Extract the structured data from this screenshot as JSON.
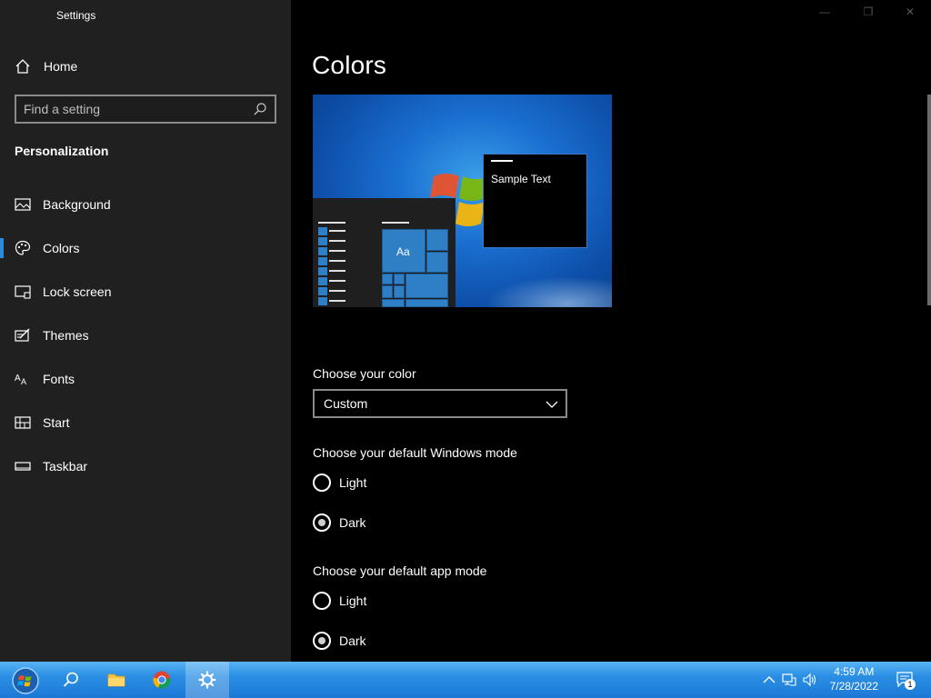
{
  "window": {
    "app_title": "Settings",
    "controls": {
      "minimize": "—",
      "maximize": "❐",
      "close": "✕"
    }
  },
  "sidebar": {
    "home_label": "Home",
    "search": {
      "placeholder": "Find a setting",
      "value": ""
    },
    "section_title": "Personalization",
    "items": [
      {
        "label": "Background",
        "icon": "picture-icon",
        "selected": false
      },
      {
        "label": "Colors",
        "icon": "palette-icon",
        "selected": true
      },
      {
        "label": "Lock screen",
        "icon": "lock-screen-icon",
        "selected": false
      },
      {
        "label": "Themes",
        "icon": "themes-icon",
        "selected": false
      },
      {
        "label": "Fonts",
        "icon": "fonts-icon",
        "selected": false
      },
      {
        "label": "Start",
        "icon": "start-icon",
        "selected": false
      },
      {
        "label": "Taskbar",
        "icon": "taskbar-icon",
        "selected": false
      }
    ]
  },
  "main": {
    "title": "Colors",
    "preview": {
      "sample_text": "Sample Text",
      "tile_text": "Aa"
    },
    "choose_color": {
      "label": "Choose your color",
      "selected": "Custom"
    },
    "windows_mode": {
      "label": "Choose your default Windows mode",
      "options": [
        "Light",
        "Dark"
      ],
      "selected": "Dark"
    },
    "app_mode": {
      "label": "Choose your default app mode",
      "options": [
        "Light",
        "Dark"
      ],
      "selected": "Dark"
    }
  },
  "taskbar": {
    "apps": [
      "start-orb-icon",
      "search-icon",
      "file-explorer-icon",
      "chrome-icon",
      "settings-gear-icon"
    ],
    "active_app": "settings-gear-icon",
    "clock": {
      "time": "4:59 AM",
      "date": "7/28/2022"
    },
    "notification_count": "1"
  },
  "colors": {
    "sidebar_bg": "#202020",
    "main_bg": "#000000",
    "accent": "#2d8ad9",
    "taskbar": "#1b78d4"
  }
}
